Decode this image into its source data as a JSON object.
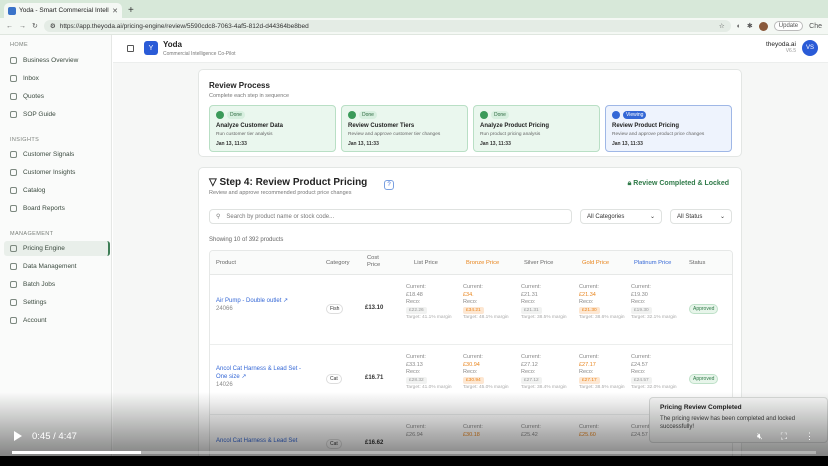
{
  "browser": {
    "tab_title": "Yoda - Smart Commercial Intellig",
    "url": "https://app.theyoda.ai/pricing-engine/review/5590cdc8-7063-4af5-812d-d44364be8bed",
    "update_label": "Update",
    "extra_label": "Che"
  },
  "app": {
    "brand": "Yoda",
    "tagline": "Commercial Intelligence Co-Pilot",
    "user_name": "theyoda.ai",
    "user_version": "V6.5",
    "user_initials": "VS"
  },
  "sidebar": {
    "home_title": "HOME",
    "home": [
      "Business Overview",
      "Inbox",
      "Quotes",
      "SOP Guide"
    ],
    "insights_title": "INSIGHTS",
    "insights": [
      "Customer Signals",
      "Customer Insights",
      "Catalog",
      "Board Reports"
    ],
    "management_title": "MANAGEMENT",
    "management": [
      "Pricing Engine",
      "Data Management",
      "Batch Jobs",
      "Settings",
      "Account"
    ]
  },
  "review_process": {
    "title": "Review Process",
    "subtitle": "Complete each step in sequence",
    "steps": [
      {
        "badge": "Done",
        "title": "Analyze Customer Data",
        "desc": "Run customer tier analysis",
        "date": "Jan 13, 11:33"
      },
      {
        "badge": "Done",
        "title": "Review Customer Tiers",
        "desc": "Review and approve customer tier changes",
        "date": "Jan 13, 11:33"
      },
      {
        "badge": "Done",
        "title": "Analyze Product Pricing",
        "desc": "Run product pricing analysis",
        "date": "Jan 13, 11:33"
      },
      {
        "badge": "Viewing",
        "title": "Review Product Pricing",
        "desc": "Review and approve product price changes",
        "date": "Jan 13, 11:33"
      }
    ]
  },
  "step4": {
    "title": "Step 4: Review Product Pricing",
    "subtitle": "Review and approve recommended product price changes",
    "locked": "Review Completed & Locked",
    "search_placeholder": "Search by product name or stock code...",
    "category_filter": "All Categories",
    "status_filter": "All Status",
    "count": "Showing 10 of 392 products",
    "headers": [
      "Product",
      "Category",
      "Cost Price",
      "List Price",
      "Bronze Price",
      "Silver Price",
      "Gold Price",
      "Platinum Price",
      "Status"
    ],
    "rows": [
      {
        "name": "Air Pump - Double outlet",
        "code": "24066",
        "category": "Fish",
        "cost": "£13.10",
        "list": {
          "current": "£18.48",
          "reco": "£22.26",
          "target": "Target: 41.1% margin"
        },
        "bronze": {
          "current": "£34.",
          "reco": "£34.21",
          "target": "Target: 48.1% margin"
        },
        "silver": {
          "current": "£21.31",
          "reco": "£21.31",
          "target": "Target: 38.5% margin"
        },
        "gold": {
          "current": "£21.34",
          "reco": "£21.30",
          "target": "Target: 38.6% margin"
        },
        "platinum": {
          "current": "£19.30",
          "reco": "£19.30",
          "target": "Target: 32.1% margin"
        },
        "status": "Approved"
      },
      {
        "name": "Ancol Cat Harness & Lead Set - One size",
        "code": "14026",
        "category": "Cat",
        "cost": "£16.71",
        "list": {
          "current": "£33.13",
          "reco": "£28.32",
          "target": "Target: 41.0% margin"
        },
        "bronze": {
          "current": "£30.94",
          "reco": "£30.94",
          "target": "Target: 45.0% margin"
        },
        "silver": {
          "current": "£27.12",
          "reco": "£27.12",
          "target": "Target: 38.4% margin"
        },
        "gold": {
          "current": "£27.17",
          "reco": "£27.17",
          "target": "Target: 38.5% margin"
        },
        "platinum": {
          "current": "£24.57",
          "reco": "£24.57",
          "target": "Target: 32.0% margin"
        },
        "status": "Approved"
      },
      {
        "name": "Ancol Cat Harness & Lead Set",
        "code": "",
        "category": "Cat",
        "cost": "£16.62",
        "list": {
          "current": "£26.94",
          "reco": "",
          "target": ""
        },
        "bronze": {
          "current": "£30.18",
          "reco": "",
          "target": ""
        },
        "silver": {
          "current": "£25.42",
          "reco": "",
          "target": ""
        },
        "gold": {
          "current": "£25.60",
          "reco": "",
          "target": ""
        },
        "platinum": {
          "current": "£24.57",
          "reco": "",
          "target": ""
        },
        "status": ""
      }
    ],
    "current_prefix": "Current:",
    "reco_prefix": "Reco:"
  },
  "toast": {
    "title": "Pricing Review Completed",
    "message": "The pricing review has been completed and locked successfully!"
  },
  "video": {
    "time": "0:45 / 4:47",
    "progress": 0.16
  }
}
